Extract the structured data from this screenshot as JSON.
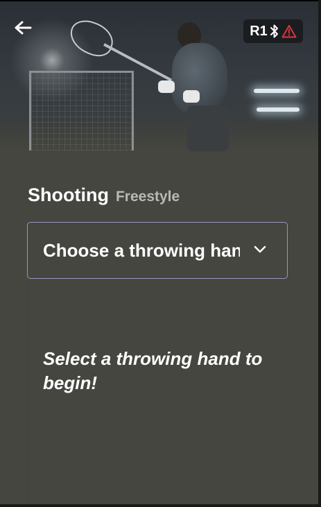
{
  "header": {
    "back_icon": "arrow-left-icon",
    "device_label": "R1",
    "bluetooth_icon": "bluetooth-icon",
    "warning_icon": "warning-triangle-icon",
    "warning_color": "#e0323f"
  },
  "activity": {
    "title": "Shooting",
    "mode": "Freestyle"
  },
  "throwing_hand_select": {
    "value": "Choose a throwing hand",
    "chevron_icon": "chevron-down-icon",
    "border_color": "#9b94c4"
  },
  "empty_state": {
    "message": "Select a throwing hand to begin!"
  },
  "colors": {
    "background": "#45463f",
    "text": "#ffffff",
    "subtitle": "#b9bab3"
  }
}
